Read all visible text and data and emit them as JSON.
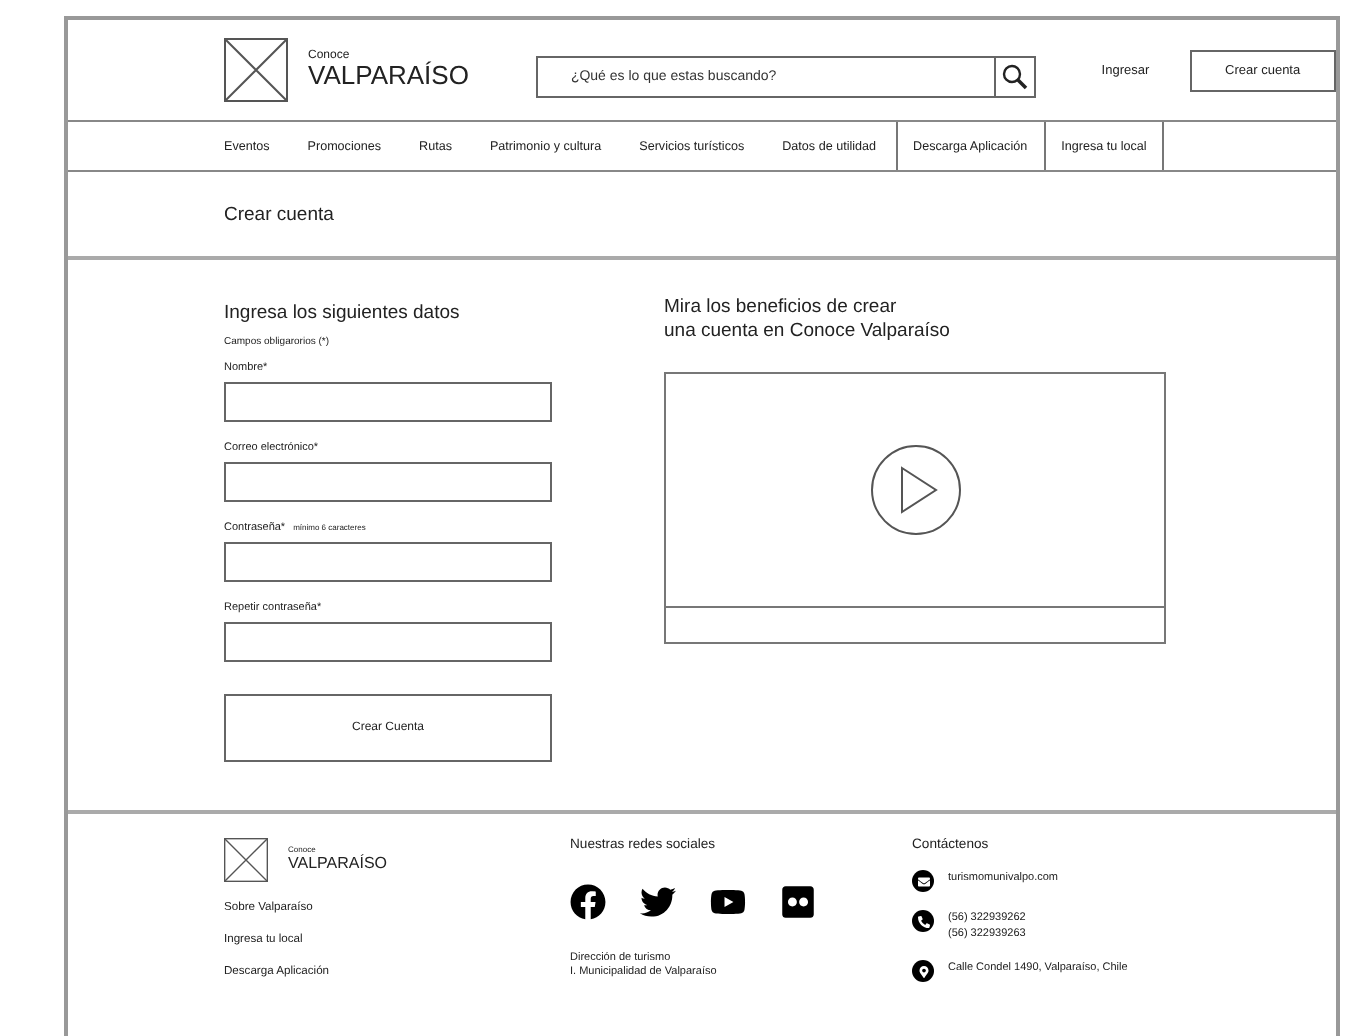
{
  "header": {
    "logo": {
      "small": "Conoce",
      "name": "VALPARAÍSO"
    },
    "search": {
      "placeholder": "¿Qué es lo que estas buscando?"
    },
    "login": "Ingresar",
    "signup": "Crear cuenta"
  },
  "nav": [
    {
      "label": "Eventos",
      "boxed": false
    },
    {
      "label": "Promociones",
      "boxed": false
    },
    {
      "label": "Rutas",
      "boxed": false
    },
    {
      "label": "Patrimonio y cultura",
      "boxed": false
    },
    {
      "label": "Servicios turísticos",
      "boxed": false
    },
    {
      "label": "Datos de utilidad",
      "boxed": false
    },
    {
      "label": "Descarga Aplicación",
      "boxed": true
    },
    {
      "label": "Ingresa tu local",
      "boxed": true
    }
  ],
  "page_title": "Crear cuenta",
  "form": {
    "heading": "Ingresa los siguientes datos",
    "note": "Campos obligarorios (*)",
    "fields": [
      {
        "label": "Nombre*"
      },
      {
        "label": "Correo electrónico*"
      },
      {
        "label": "Contraseña*",
        "hint": "mínimo 6 caracteres"
      },
      {
        "label": "Repetir contraseña*"
      }
    ],
    "submit": "Crear Cuenta"
  },
  "video": {
    "heading": [
      "Mira los beneficios de crear",
      "una cuenta en Conoce Valparaíso"
    ]
  },
  "footer": {
    "logo": {
      "small": "Conoce",
      "name": "VALPARAÍSO"
    },
    "links": [
      "Sobre Valparaíso",
      "Ingresa tu local",
      "Descarga Aplicación"
    ],
    "social": {
      "heading": "Nuestras redes sociales",
      "networks": [
        {
          "kind": "facebook"
        },
        {
          "kind": "twitter"
        },
        {
          "kind": "youtube"
        },
        {
          "kind": "flickr"
        }
      ],
      "org": [
        "Dirección de turismo",
        "I. Municipalidad de Valparaíso"
      ]
    },
    "contact": {
      "heading": "Contáctenos",
      "items": [
        {
          "kind": "mail",
          "lines": [
            "turismomunivalpo.com"
          ]
        },
        {
          "kind": "phone",
          "lines": [
            "(56) 322939262",
            "(56) 322939263"
          ]
        },
        {
          "kind": "location",
          "lines": [
            "Calle Condel 1490, Valparaíso, Chile"
          ]
        }
      ]
    }
  }
}
